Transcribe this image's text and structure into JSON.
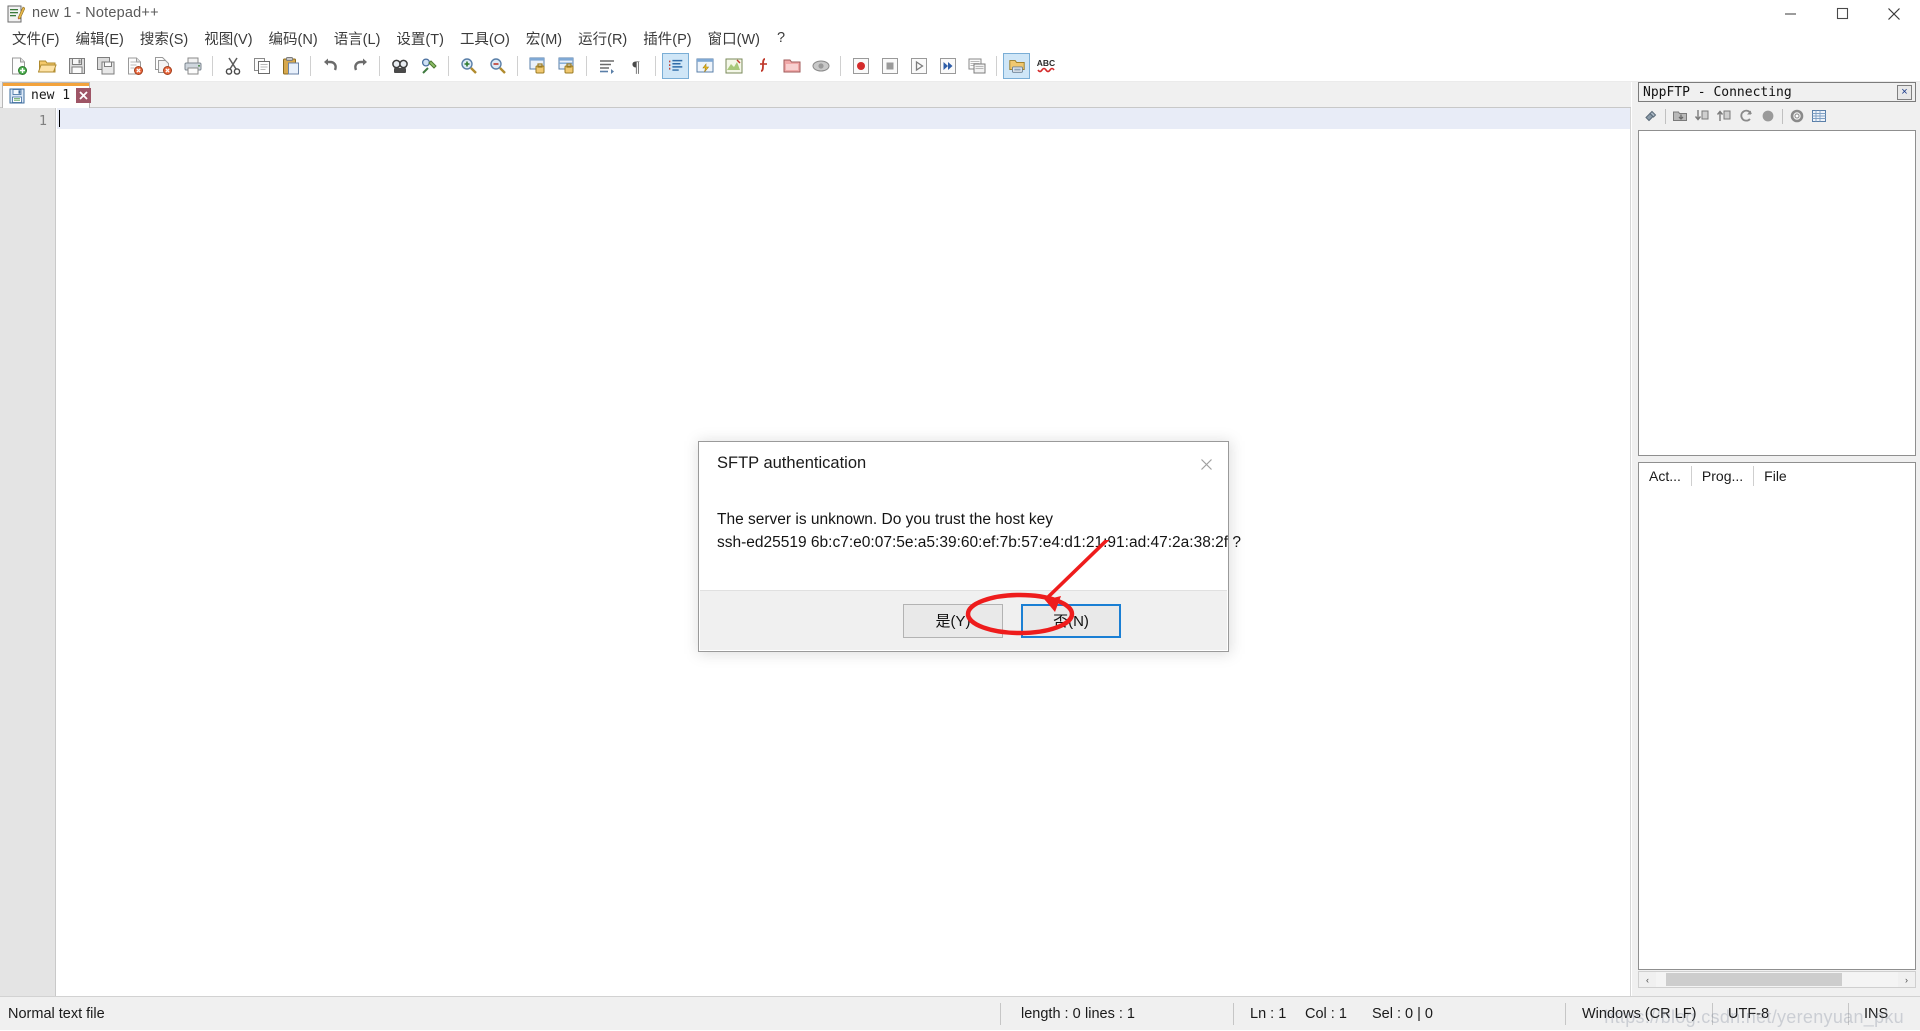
{
  "window": {
    "title": "new 1 - Notepad++",
    "icon": "notepad-plus-plus-icon",
    "controls": {
      "minimize": "minimize-icon",
      "maximize": "maximize-icon",
      "close": "close-icon"
    }
  },
  "menubar": {
    "items": [
      {
        "label": "文件(F)",
        "name": "menu-file"
      },
      {
        "label": "编辑(E)",
        "name": "menu-edit"
      },
      {
        "label": "搜索(S)",
        "name": "menu-search"
      },
      {
        "label": "视图(V)",
        "name": "menu-view"
      },
      {
        "label": "编码(N)",
        "name": "menu-encoding"
      },
      {
        "label": "语言(L)",
        "name": "menu-language"
      },
      {
        "label": "设置(T)",
        "name": "menu-settings"
      },
      {
        "label": "工具(O)",
        "name": "menu-tools"
      },
      {
        "label": "宏(M)",
        "name": "menu-macro"
      },
      {
        "label": "运行(R)",
        "name": "menu-run"
      },
      {
        "label": "插件(P)",
        "name": "menu-plugins"
      },
      {
        "label": "窗口(W)",
        "name": "menu-window"
      },
      {
        "label": "?",
        "name": "menu-help"
      }
    ]
  },
  "toolbar": {
    "buttons": [
      {
        "name": "new-file-icon",
        "glyph": "new"
      },
      {
        "name": "open-file-icon",
        "glyph": "open"
      },
      {
        "name": "save-icon",
        "glyph": "save"
      },
      {
        "name": "save-all-icon",
        "glyph": "saveall"
      },
      {
        "name": "close-file-icon",
        "glyph": "closedoc"
      },
      {
        "name": "close-all-files-icon",
        "glyph": "closeall"
      },
      {
        "name": "print-icon",
        "glyph": "print"
      },
      {
        "name": "separator",
        "glyph": "sep"
      },
      {
        "name": "cut-icon",
        "glyph": "cut"
      },
      {
        "name": "copy-icon",
        "glyph": "copy"
      },
      {
        "name": "paste-icon",
        "glyph": "paste"
      },
      {
        "name": "separator",
        "glyph": "sep"
      },
      {
        "name": "undo-icon",
        "glyph": "undo"
      },
      {
        "name": "redo-icon",
        "glyph": "redo"
      },
      {
        "name": "separator",
        "glyph": "sep"
      },
      {
        "name": "find-icon",
        "glyph": "find"
      },
      {
        "name": "replace-icon",
        "glyph": "replace"
      },
      {
        "name": "separator",
        "glyph": "sep"
      },
      {
        "name": "zoom-in-icon",
        "glyph": "zoomin"
      },
      {
        "name": "zoom-out-icon",
        "glyph": "zoomout"
      },
      {
        "name": "separator",
        "glyph": "sep"
      },
      {
        "name": "sync-vertical-scroll-icon",
        "glyph": "syncv"
      },
      {
        "name": "sync-horizontal-scroll-icon",
        "glyph": "synch"
      },
      {
        "name": "separator",
        "glyph": "sep"
      },
      {
        "name": "word-wrap-icon",
        "glyph": "wrap"
      },
      {
        "name": "show-all-characters-icon",
        "glyph": "pilcrow"
      },
      {
        "name": "separator",
        "glyph": "sep"
      },
      {
        "name": "indent-guide-icon",
        "glyph": "indent",
        "active": true
      },
      {
        "name": "user-defined-language-icon",
        "glyph": "udl"
      },
      {
        "name": "document-map-icon",
        "glyph": "docmap"
      },
      {
        "name": "function-list-icon",
        "glyph": "funclist"
      },
      {
        "name": "folder-as-workspace-icon",
        "glyph": "workspace"
      },
      {
        "name": "monitoring-icon",
        "glyph": "monitor"
      },
      {
        "name": "separator",
        "glyph": "sep"
      },
      {
        "name": "record-macro-icon",
        "glyph": "record"
      },
      {
        "name": "stop-macro-icon",
        "glyph": "stop"
      },
      {
        "name": "play-macro-icon",
        "glyph": "play"
      },
      {
        "name": "play-multiple-macro-icon",
        "glyph": "playmulti"
      },
      {
        "name": "save-macro-icon",
        "glyph": "savemacro"
      },
      {
        "name": "separator",
        "glyph": "sep"
      },
      {
        "name": "show-nppftp-window-icon",
        "glyph": "ftp",
        "active": true
      },
      {
        "name": "spell-check-icon",
        "glyph": "abc"
      }
    ]
  },
  "tabs": {
    "items": [
      {
        "label": "new 1",
        "icon": "saved-file-icon",
        "close": "close-tab-icon"
      }
    ]
  },
  "editor": {
    "line_numbers": [
      "1"
    ],
    "content": ""
  },
  "ftp_panel": {
    "title": "NppFTP - Connecting",
    "close_label": "×",
    "toolbar": [
      {
        "name": "connect-icon"
      },
      {
        "name": "separator"
      },
      {
        "name": "download-folder-icon"
      },
      {
        "name": "download-file-icon"
      },
      {
        "name": "upload-file-icon"
      },
      {
        "name": "refresh-icon"
      },
      {
        "name": "abort-icon"
      },
      {
        "name": "separator"
      },
      {
        "name": "settings-gear-icon"
      },
      {
        "name": "messages-icon"
      }
    ],
    "tabs": [
      {
        "label": "Act...",
        "name": "ftp-tab-actions"
      },
      {
        "label": "Prog...",
        "name": "ftp-tab-progress"
      },
      {
        "label": "File",
        "name": "ftp-tab-file"
      }
    ],
    "scroll": {
      "left_arrow": "‹",
      "right_arrow": "›"
    }
  },
  "statusbar": {
    "file_type": "Normal text file",
    "length": "length : 0",
    "lines": "lines : 1",
    "ln": "Ln : 1",
    "col": "Col : 1",
    "sel": "Sel : 0 | 0",
    "eol": "Windows (CR LF)",
    "encoding": "UTF-8",
    "mode": "INS"
  },
  "dialog": {
    "title": "SFTP authentication",
    "close_label": "✕",
    "message_line1": "The server is unknown. Do you trust the host key",
    "message_line2": "ssh-ed25519 6b:c7:e0:07:5e:a5:39:60:ef:7b:57:e4:d1:21:91:ad:47:2a:38:2f ?",
    "buttons": {
      "yes": "是(Y)",
      "no": "否(N)"
    }
  },
  "annotation": {
    "color": "#ee1c1c",
    "shape": "ellipse-and-arrow-pointing-to-yes-button"
  },
  "watermark": "https://blog.csdn.net/yerenyuan_pku",
  "colors": {
    "accent_orange": "#f3a33c",
    "focus_blue": "#1a7fd4",
    "annotation_red": "#ee1c1c",
    "current_line": "#e8ecf7",
    "chrome_gray": "#f0f0f0"
  }
}
